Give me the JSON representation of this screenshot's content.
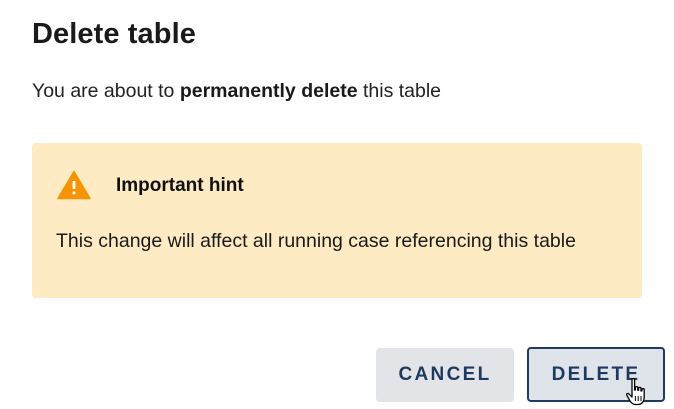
{
  "dialog": {
    "title": "Delete table",
    "message_prefix": "You are about to ",
    "message_bold": "permanently delete",
    "message_suffix": " this table",
    "hint": {
      "icon": "warning-icon",
      "title": "Important hint",
      "text": "This change will affect all running case referencing this table",
      "background_color": "#feeac3",
      "icon_color": "#f59300"
    },
    "buttons": {
      "cancel_label": "CANCEL",
      "delete_label": "DELETE"
    },
    "accent_color": "#1f3a5f"
  }
}
